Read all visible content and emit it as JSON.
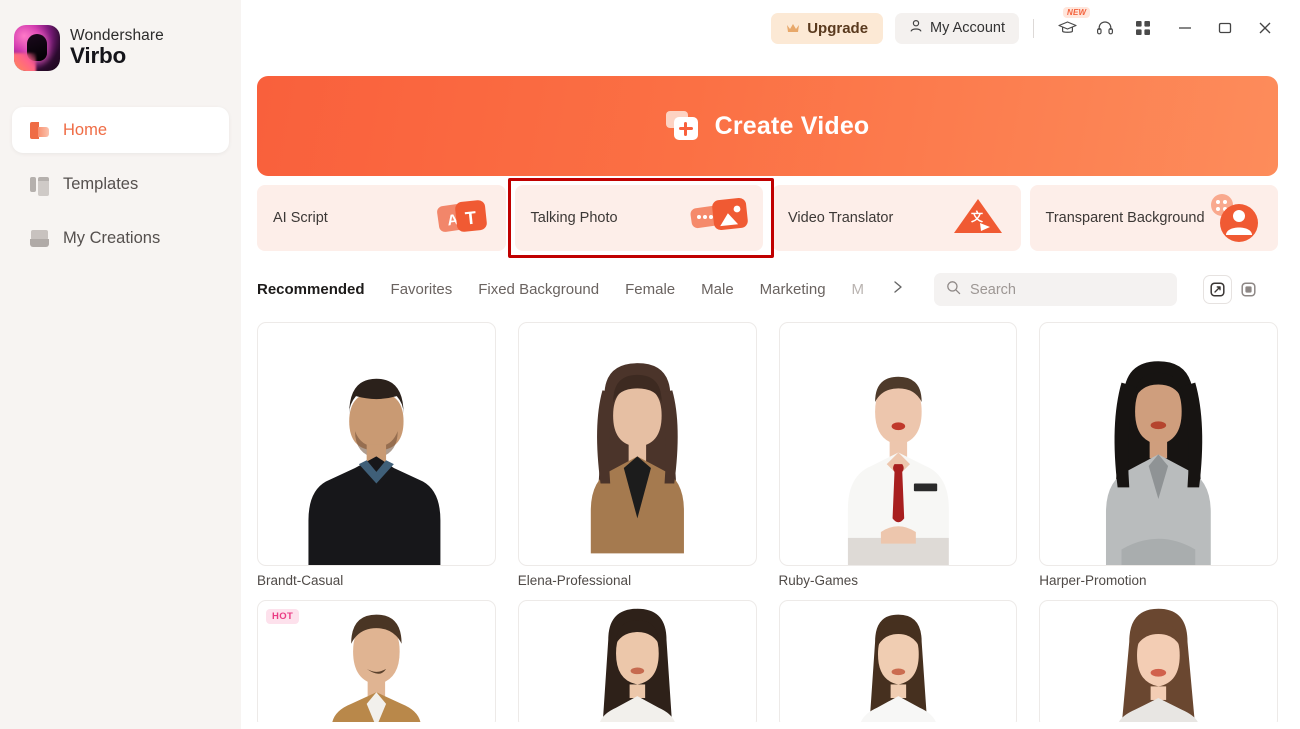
{
  "app": {
    "brand_line1": "Wondershare",
    "brand_line2": "Virbo",
    "logo_icon": "virbo-logo-icon",
    "accent_color": "#ef6c45",
    "banner_gradient_start": "#f9603c",
    "banner_gradient_end": "#fd8c5b",
    "highlight_color": "#c00000"
  },
  "sidebar": {
    "items": [
      {
        "label": "Home",
        "icon": "home-icon",
        "active": true
      },
      {
        "label": "Templates",
        "icon": "templates-icon",
        "active": false
      },
      {
        "label": "My Creations",
        "icon": "my-creations-icon",
        "active": false
      }
    ]
  },
  "header": {
    "upgrade_label": "Upgrade",
    "upgrade_icon": "crown-icon",
    "account_label": "My Account",
    "account_icon": "person-icon",
    "icons": [
      {
        "name": "graduation-cap-icon",
        "badge": "NEW"
      },
      {
        "name": "headset-support-icon",
        "badge": ""
      },
      {
        "name": "apps-grid-icon",
        "badge": ""
      }
    ],
    "window_controls": [
      {
        "name": "minimize-button",
        "glyph": "—"
      },
      {
        "name": "maximize-button",
        "glyph": "▢"
      },
      {
        "name": "close-button",
        "glyph": "✕"
      }
    ]
  },
  "banner": {
    "label": "Create Video",
    "icon": "create-video-icon"
  },
  "features": [
    {
      "label": "AI Script",
      "icon": "ai-script-icon",
      "highlighted": false
    },
    {
      "label": "Talking Photo",
      "icon": "talking-photo-icon",
      "highlighted": true
    },
    {
      "label": "Video Translator",
      "icon": "video-translator-icon",
      "highlighted": false
    },
    {
      "label": "Transparent Background",
      "icon": "transparent-background-icon",
      "highlighted": false
    }
  ],
  "tabs": [
    {
      "label": "Recommended",
      "active": true
    },
    {
      "label": "Favorites",
      "active": false
    },
    {
      "label": "Fixed Background",
      "active": false
    },
    {
      "label": "Female",
      "active": false
    },
    {
      "label": "Male",
      "active": false
    },
    {
      "label": "Marketing",
      "active": false
    },
    {
      "label": "M",
      "active": false,
      "clipped": true
    }
  ],
  "tab_next_icon": "chevron-right-icon",
  "search": {
    "placeholder": "Search",
    "value": "",
    "icon": "search-icon"
  },
  "view_toggles": [
    {
      "name": "avatar-view-toggle",
      "selected": true
    },
    {
      "name": "scene-view-toggle",
      "selected": false
    }
  ],
  "avatars": {
    "row1": [
      {
        "name": "Brandt-Casual",
        "badge": ""
      },
      {
        "name": "Elena-Professional",
        "badge": ""
      },
      {
        "name": "Ruby-Games",
        "badge": ""
      },
      {
        "name": "Harper-Promotion",
        "badge": ""
      }
    ],
    "row2": [
      {
        "name": "",
        "badge": "HOT"
      },
      {
        "name": "",
        "badge": ""
      },
      {
        "name": "",
        "badge": ""
      },
      {
        "name": "",
        "badge": ""
      }
    ]
  }
}
